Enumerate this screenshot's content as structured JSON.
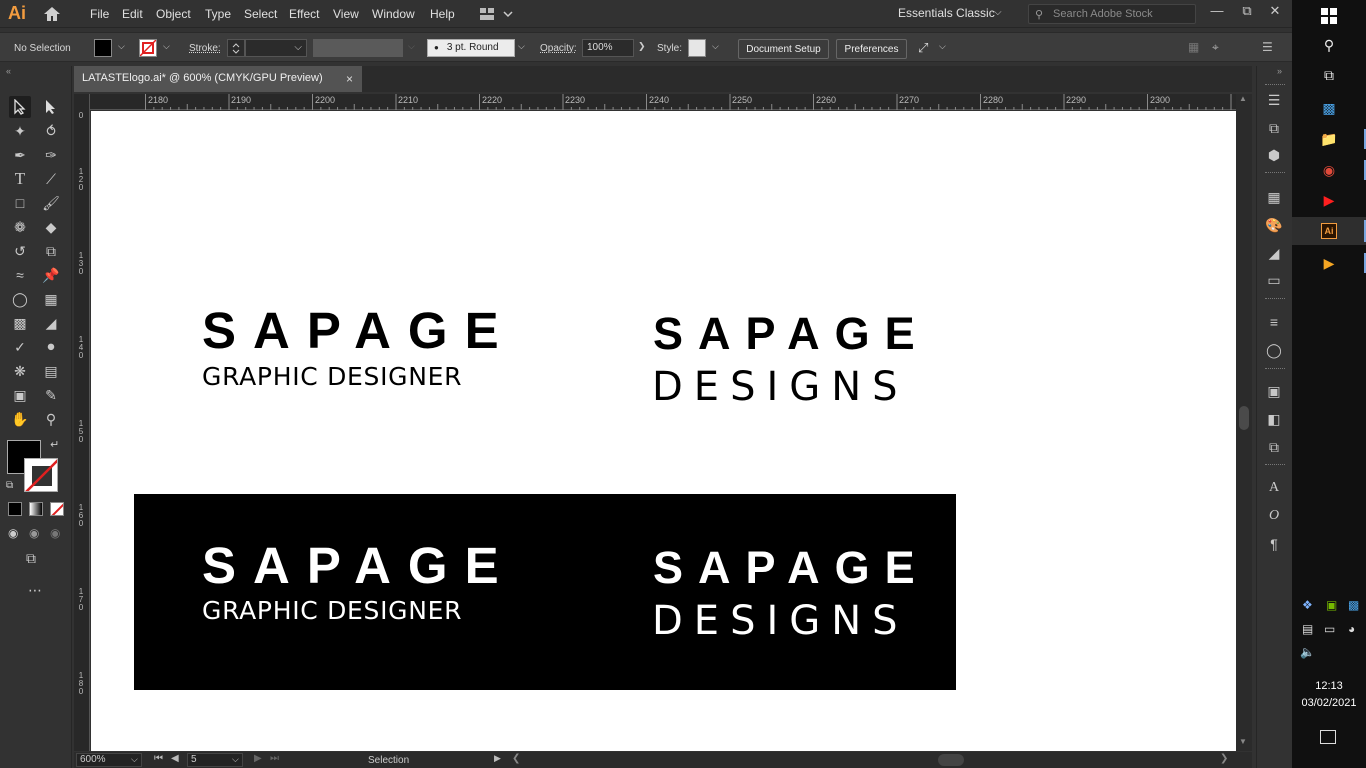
{
  "app": {
    "logo": "Ai",
    "menus": [
      "File",
      "Edit",
      "Object",
      "Type",
      "Select",
      "Effect",
      "View",
      "Window",
      "Help"
    ],
    "workspace": "Essentials Classic",
    "stock_search_placeholder": "Search Adobe Stock"
  },
  "control_bar": {
    "selection_status": "No Selection",
    "stroke_label": "Stroke:",
    "brush_label": "3 pt. Round",
    "opacity_label": "Opacity:",
    "opacity_value": "100%",
    "style_label": "Style:",
    "document_setup": "Document Setup",
    "preferences": "Preferences"
  },
  "document_tab": {
    "title": "LATASTElogo.ai* @ 600% (CMYK/GPU Preview)",
    "close": "×"
  },
  "ruler_top": [
    "2180",
    "2190",
    "2200",
    "2210",
    "2220",
    "2230",
    "2240",
    "2250",
    "2260",
    "2270",
    "2280",
    "2290",
    "2300"
  ],
  "ruler_left": [
    "0",
    "1 2 0",
    "1 3 0",
    "1 4 0",
    "1 5 0",
    "1 6 0",
    "1 7 0",
    "1 8 0"
  ],
  "artboard": {
    "logos": [
      {
        "main": "SAPAGE",
        "sub": "GRAPHIC DESIGNER",
        "theme": "dark-on-light"
      },
      {
        "main": "SAPAGE",
        "sub": "DESIGNS",
        "theme": "dark-on-light"
      },
      {
        "main": "SAPAGE",
        "sub": "GRAPHIC DESIGNER",
        "theme": "light-on-dark"
      },
      {
        "main": "SAPAGE",
        "sub": "DESIGNS",
        "theme": "light-on-dark"
      }
    ]
  },
  "status_bar": {
    "zoom": "600%",
    "artboard_number": "5",
    "tool_status": "Selection"
  },
  "taskbar": {
    "time": "12:13",
    "date": "03/02/2021",
    "ai_label": "Ai"
  },
  "colors": {
    "accent_ai": "#f39c3f",
    "fill": "#000000",
    "stroke_none": "#ff0000"
  }
}
